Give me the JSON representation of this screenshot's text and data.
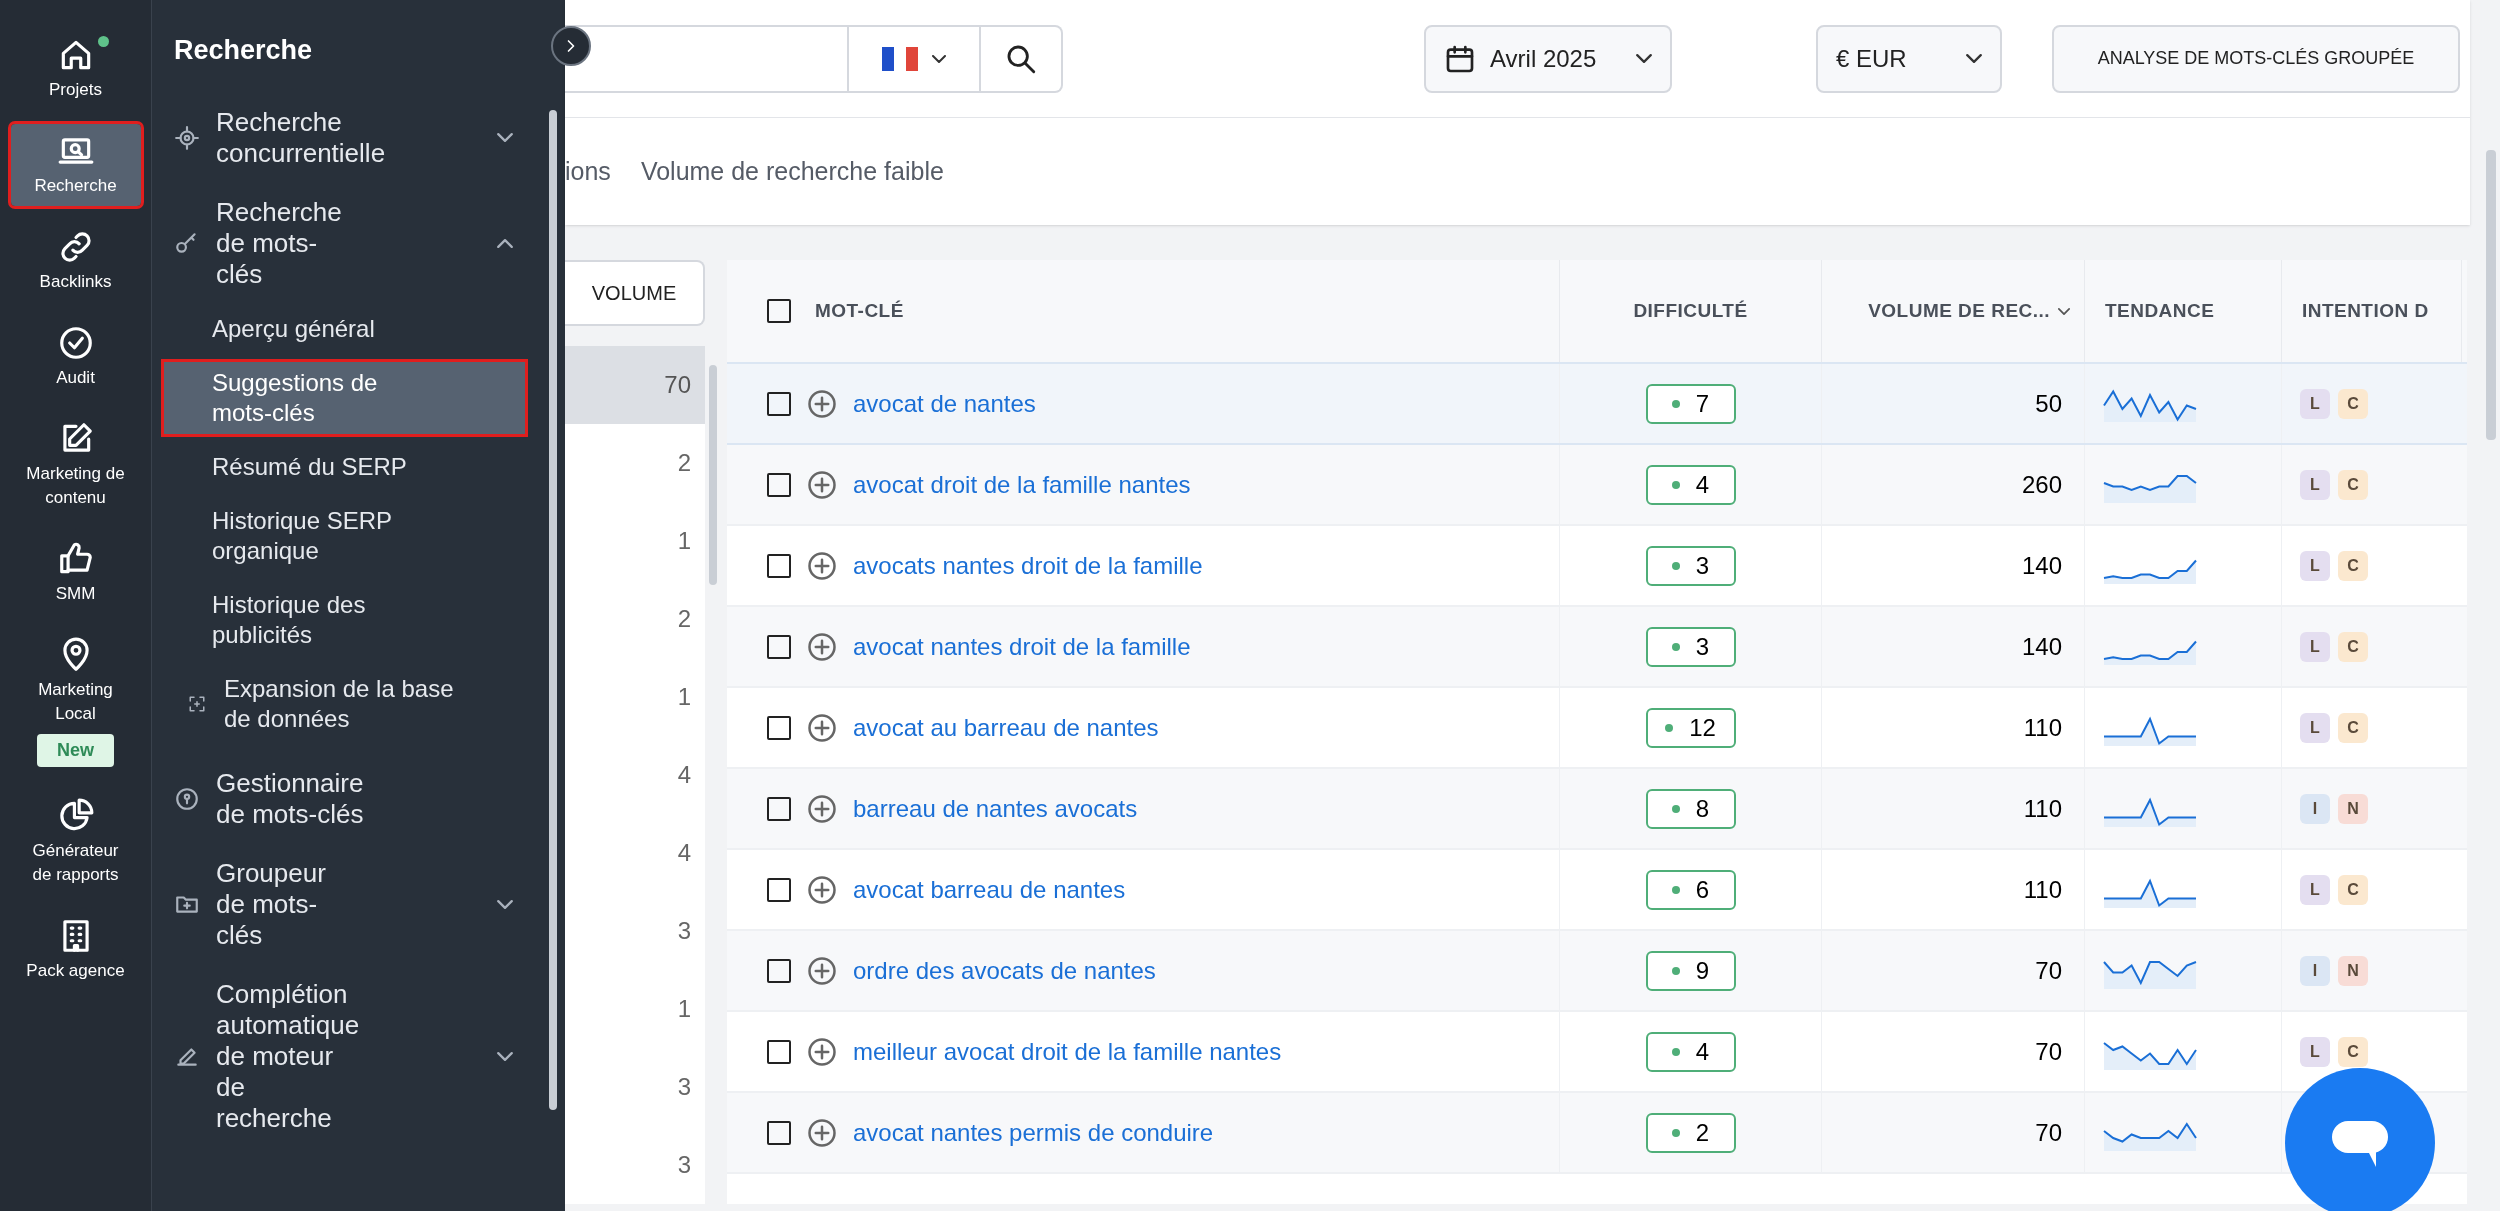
{
  "rail": [
    {
      "label": "Projets",
      "notification": true,
      "selected": false
    },
    {
      "label": "Recherche",
      "notification": false,
      "selected": true
    },
    {
      "label": "Backlinks",
      "notification": false,
      "selected": false
    },
    {
      "label": "Audit",
      "notification": false,
      "selected": false
    },
    {
      "label": "Marketing de contenu",
      "notification": false,
      "selected": false
    },
    {
      "label": "SMM",
      "notification": false,
      "selected": false
    },
    {
      "label": "Marketing Local",
      "notification": false,
      "selected": false,
      "badge": "New"
    },
    {
      "label": "Générateur de rapports",
      "notification": false,
      "selected": false
    },
    {
      "label": "Pack agence",
      "notification": false,
      "selected": false
    }
  ],
  "submenu": {
    "title": "Recherche",
    "groups": [
      {
        "label": "Recherche concurrentielle",
        "expanded": false
      },
      {
        "label": "Recherche de mots-clés",
        "expanded": true,
        "children": [
          {
            "label": "Aperçu général",
            "kind": "bullet",
            "selected": false
          },
          {
            "label": "Suggestions de mots-clés",
            "kind": "bullet",
            "selected": true
          },
          {
            "label": "Résumé du SERP",
            "kind": "bullet",
            "selected": false
          },
          {
            "label": "Historique SERP organique",
            "kind": "bullet",
            "selected": false
          },
          {
            "label": "Historique des publicités",
            "kind": "bullet",
            "selected": false
          },
          {
            "label": "Expansion de la base de données",
            "kind": "icon",
            "selected": false
          }
        ]
      },
      {
        "label": "Gestionnaire de mots-clés"
      },
      {
        "label": "Groupeur de mots-clés",
        "expanded": false
      },
      {
        "label": "Complétion automatique de moteur de recherche",
        "expanded": false
      }
    ]
  },
  "toolbar": {
    "date": "Avril 2025",
    "currency": "€ EUR",
    "bulk_button": "ANALYSE DE MOTS-CLÉS GROUPÉE"
  },
  "tabs": [
    {
      "label": "ions",
      "selected": false
    },
    {
      "label": "Volume de recherche faible",
      "selected": false
    }
  ],
  "filter": {
    "button": "VOLUME",
    "counts": [
      {
        "label": "70",
        "selected": true
      },
      {
        "label": "2",
        "selected": false
      },
      {
        "label": "1",
        "selected": false
      },
      {
        "label": "2",
        "selected": false
      },
      {
        "label": "1",
        "selected": false
      },
      {
        "label": "4",
        "selected": false
      },
      {
        "label": "4",
        "selected": false
      },
      {
        "label": "3",
        "selected": false
      },
      {
        "label": "1",
        "selected": false
      },
      {
        "label": "3",
        "selected": false
      },
      {
        "label": "3",
        "selected": false
      }
    ]
  },
  "table": {
    "header_checked": false,
    "columns": [
      "MOT-CLÉ",
      "DIFFICULTÉ",
      "VOLUME DE REC...",
      "TENDANCE",
      "INTENTION D"
    ],
    "rows": [
      {
        "keyword": "avocat de nantes",
        "difficulty": "7",
        "volume": "50",
        "checked": false,
        "selected": true,
        "intent": [
          {
            "label": "L",
            "color": "#e4def0"
          },
          {
            "label": "C",
            "color": "#fbe8cf"
          }
        ]
      },
      {
        "keyword": "avocat droit de la famille nantes",
        "difficulty": "4",
        "volume": "260",
        "checked": false,
        "selected": false,
        "intent": [
          {
            "label": "L",
            "color": "#e4def0"
          },
          {
            "label": "C",
            "color": "#fbe8cf"
          }
        ]
      },
      {
        "keyword": "avocats nantes droit de la famille",
        "difficulty": "3",
        "volume": "140",
        "checked": false,
        "selected": false,
        "intent": [
          {
            "label": "L",
            "color": "#e4def0"
          },
          {
            "label": "C",
            "color": "#fbe8cf"
          }
        ]
      },
      {
        "keyword": "avocat nantes droit de la famille",
        "difficulty": "3",
        "volume": "140",
        "checked": false,
        "selected": false,
        "intent": [
          {
            "label": "L",
            "color": "#e4def0"
          },
          {
            "label": "C",
            "color": "#fbe8cf"
          }
        ]
      },
      {
        "keyword": "avocat au barreau de nantes",
        "difficulty": "12",
        "volume": "110",
        "checked": false,
        "selected": false,
        "intent": [
          {
            "label": "L",
            "color": "#e4def0"
          },
          {
            "label": "C",
            "color": "#fbe8cf"
          }
        ]
      },
      {
        "keyword": "barreau de nantes avocats",
        "difficulty": "8",
        "volume": "110",
        "checked": false,
        "selected": false,
        "intent": [
          {
            "label": "I",
            "color": "#dbe6f4"
          },
          {
            "label": "N",
            "color": "#f8dcd6"
          }
        ]
      },
      {
        "keyword": "avocat barreau de nantes",
        "difficulty": "6",
        "volume": "110",
        "checked": false,
        "selected": false,
        "intent": [
          {
            "label": "L",
            "color": "#e4def0"
          },
          {
            "label": "C",
            "color": "#fbe8cf"
          }
        ]
      },
      {
        "keyword": "ordre des avocats de nantes",
        "difficulty": "9",
        "volume": "70",
        "checked": false,
        "selected": false,
        "intent": [
          {
            "label": "I",
            "color": "#dbe6f4"
          },
          {
            "label": "N",
            "color": "#f8dcd6"
          }
        ]
      },
      {
        "keyword": "meilleur avocat droit de la famille nantes",
        "difficulty": "4",
        "volume": "70",
        "checked": false,
        "selected": false,
        "intent": [
          {
            "label": "L",
            "color": "#e4def0"
          },
          {
            "label": "C",
            "color": "#fbe8cf"
          }
        ]
      },
      {
        "keyword": "avocat nantes permis de conduire",
        "difficulty": "2",
        "volume": "70",
        "checked": false,
        "selected": false,
        "intent": []
      }
    ]
  }
}
